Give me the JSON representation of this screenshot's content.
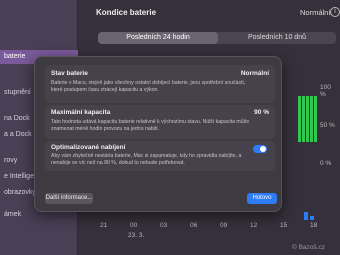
{
  "sidebar": {
    "items": [
      {
        "label": "baterie",
        "active": true
      },
      {
        "label": "stupnění",
        "active": false
      },
      {
        "label": "na Dock",
        "active": false
      },
      {
        "label": "a a Dock",
        "active": false
      },
      {
        "label": "rovy",
        "active": false
      },
      {
        "label": "e Intelligen",
        "active": false
      },
      {
        "label": "obrazovky",
        "active": false
      },
      {
        "label": "ámek",
        "active": false
      }
    ]
  },
  "header": {
    "title": "Kondice baterie",
    "value": "Normální",
    "info_icon": "info-icon"
  },
  "segments": {
    "tabs": [
      "Posledních 24 hodin",
      "Posledních 10 dnů"
    ]
  },
  "chart": {
    "y_labels": [
      "100 %",
      "50 %",
      "0 %"
    ],
    "x_labels": [
      "21",
      "00",
      "03",
      "06",
      "09",
      "12",
      "15",
      "18"
    ],
    "date_label": "23. 3."
  },
  "dialog": {
    "sections": [
      {
        "title": "Stav baterie",
        "value": "Normální",
        "description": "Baterie v Macu, stejně jako všechny ostatní dobíjecí baterie, jsou spotřební součásti, které postupem času ztrácejí kapacitu a výkon."
      },
      {
        "title": "Maximální kapacita",
        "value": "90 %",
        "description": "Tato hodnota udává kapacitu baterie relativně k výchozímu stavu. Nižší kapacita může znamenat méně hodin provozu na jedno nabití."
      },
      {
        "title": "Optimalizované nabíjení",
        "toggle_on": true,
        "description": "Aby vám zbytečně nestárla baterie, Mac si zapamatuje, kdy ho zpravidla nabíjíte, a nenabije se víc než na 80 %, dokud to nebude potřebovat."
      }
    ],
    "more_button": "Další informace...",
    "done_button": "Hotovo"
  },
  "watermark": "© Bazoš.cz",
  "colors": {
    "accent": "#2d7cf6",
    "green_bars": "#30c850"
  }
}
